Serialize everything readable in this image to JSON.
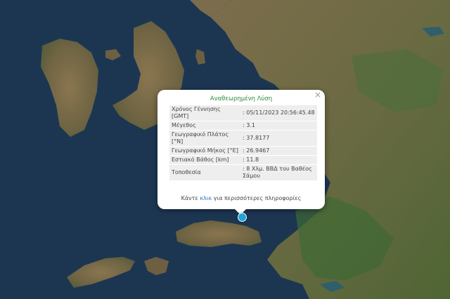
{
  "popup": {
    "title": "Αναθεωρημένη Λύση",
    "close_label": "×",
    "rows": [
      {
        "label": "Χρόνος Γέννησης [GMT]",
        "value": "05/11/2023 20:56:45.48"
      },
      {
        "label": "Μέγεθος",
        "value": "3.1"
      },
      {
        "label": "Γεωγραφικό Πλάτος [°N]",
        "value": "37.8177"
      },
      {
        "label": "Γεωγραφικό Μήκος [°E]",
        "value": "26.9467"
      },
      {
        "label": "Εστιακό Βάθος [km]",
        "value": "11.8"
      },
      {
        "label": "Τοποθεσία",
        "value": "8 Χλμ. ΒΒΔ του Βαθέος Σάμου"
      }
    ],
    "footer_before": "Κάντε ",
    "footer_link": "κλικ",
    "footer_after": " για περισσότερες πληροφορίες"
  },
  "colors": {
    "sea": "#1b3550",
    "land": "#7a6a4a",
    "title_green": "#2e8b3f",
    "link_blue": "#2a6fbd",
    "marker": "#1ea6d8"
  },
  "icons": {
    "close": "close-icon",
    "marker": "earthquake-marker-icon"
  }
}
